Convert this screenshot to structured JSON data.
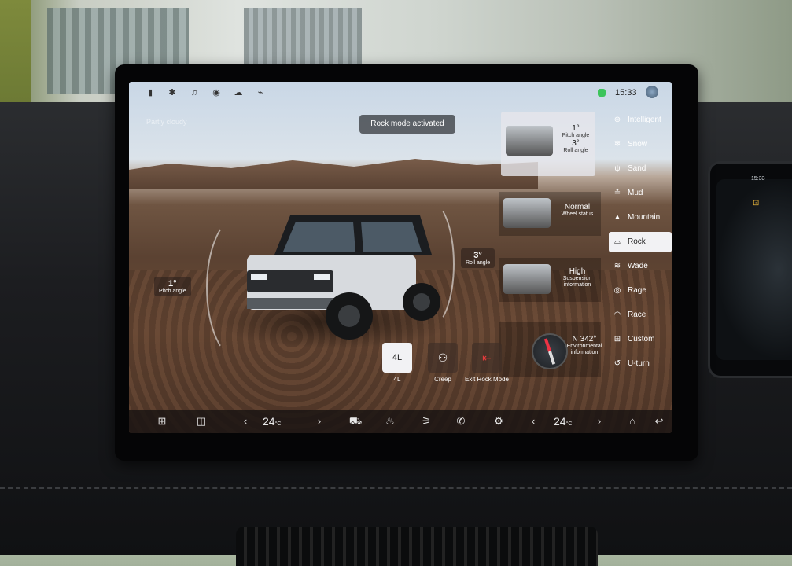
{
  "status": {
    "time": "15:33",
    "icons": [
      "signal-icon",
      "bluetooth-icon",
      "bell-icon",
      "location-icon",
      "cloud-icon",
      "hotspot-icon"
    ]
  },
  "toast": "Rock mode activated",
  "weather_hint": "Partly cloudy",
  "pitch": {
    "value": "1°",
    "label": "Pitch angle"
  },
  "roll": {
    "value": "3°",
    "label": "Roll angle"
  },
  "top_info": {
    "pitch_value": "1°",
    "pitch_label": "Pitch angle",
    "roll_value": "3°",
    "roll_label": "Roll angle"
  },
  "wheel": {
    "value": "Normal",
    "label": "Wheel status"
  },
  "suspension": {
    "value": "High",
    "label": "Suspension information"
  },
  "environment": {
    "value": "N 342°",
    "label": "Environmental information"
  },
  "modes": [
    {
      "label": "Intelligent",
      "icon": "intelligent-icon",
      "active": false
    },
    {
      "label": "Snow",
      "icon": "snow-icon",
      "active": false
    },
    {
      "label": "Sand",
      "icon": "sand-icon",
      "active": false
    },
    {
      "label": "Mud",
      "icon": "mud-icon",
      "active": false
    },
    {
      "label": "Mountain",
      "icon": "mountain-icon",
      "active": false
    },
    {
      "label": "Rock",
      "icon": "rock-icon",
      "active": true
    },
    {
      "label": "Wade",
      "icon": "wade-icon",
      "active": false
    },
    {
      "label": "Rage",
      "icon": "rage-icon",
      "active": false
    },
    {
      "label": "Race",
      "icon": "race-icon",
      "active": false
    },
    {
      "label": "Custom",
      "icon": "custom-icon",
      "active": false
    },
    {
      "label": "U-turn",
      "icon": "uturn-icon",
      "active": false
    }
  ],
  "quick": {
    "fourl_button": "4L",
    "fourl_label": "4L",
    "creep_label": "Creep",
    "exit_label": "Exit Rock Mode"
  },
  "dock": {
    "left_temp": "24",
    "right_temp": "24",
    "temp_unit": "°C",
    "icons": [
      "apps-icon",
      "split-icon",
      "car-icon",
      "defrost-icon",
      "seat-heat-icon",
      "phone-icon",
      "settings-icon",
      "home-icon",
      "back-icon"
    ]
  },
  "colors": {
    "active_mode_bg": "#f2f2f4",
    "exit_red": "#e23b3b",
    "battery_green": "#3cc45b"
  }
}
